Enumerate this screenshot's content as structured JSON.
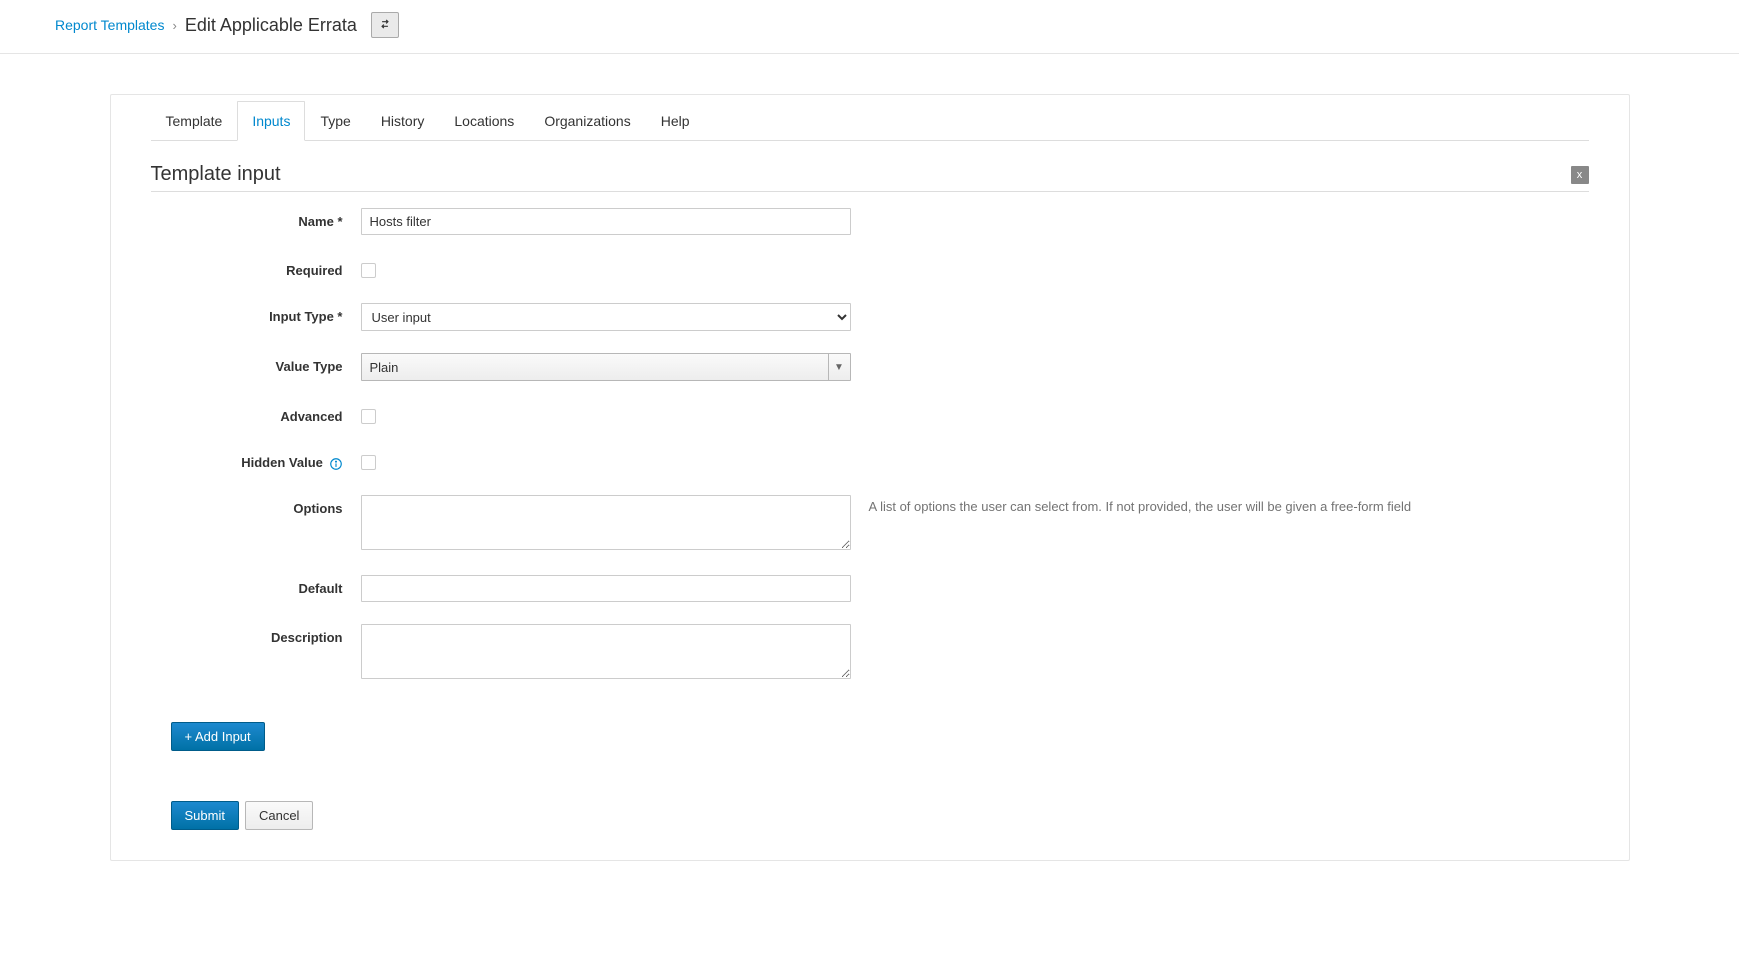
{
  "breadcrumb": {
    "link": "Report Templates",
    "current": "Edit Applicable Errata"
  },
  "tabs": [
    {
      "id": "template",
      "label": "Template",
      "active": false
    },
    {
      "id": "inputs",
      "label": "Inputs",
      "active": true
    },
    {
      "id": "type",
      "label": "Type",
      "active": false
    },
    {
      "id": "history",
      "label": "History",
      "active": false
    },
    {
      "id": "locations",
      "label": "Locations",
      "active": false
    },
    {
      "id": "organizations",
      "label": "Organizations",
      "active": false
    },
    {
      "id": "help",
      "label": "Help",
      "active": false
    }
  ],
  "section": {
    "title": "Template input",
    "close_label": "x"
  },
  "form": {
    "name": {
      "label": "Name *",
      "value": "Hosts filter"
    },
    "required": {
      "label": "Required"
    },
    "input_type": {
      "label": "Input Type *",
      "value": "User input"
    },
    "value_type": {
      "label": "Value Type",
      "value": "Plain"
    },
    "advanced": {
      "label": "Advanced"
    },
    "hidden_value": {
      "label": "Hidden Value"
    },
    "options": {
      "label": "Options",
      "help": "A list of options the user can select from. If not provided, the user will be given a free-form field"
    },
    "default": {
      "label": "Default",
      "value": ""
    },
    "description": {
      "label": "Description",
      "value": ""
    }
  },
  "buttons": {
    "add_input": "+ Add Input",
    "submit": "Submit",
    "cancel": "Cancel"
  }
}
